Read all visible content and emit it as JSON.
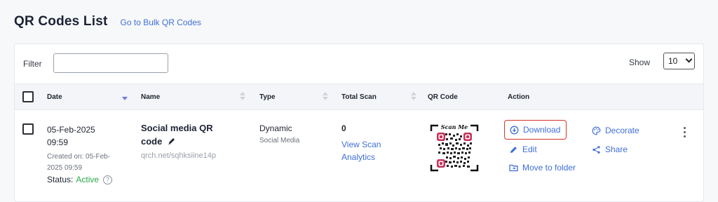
{
  "header": {
    "title": "QR Codes List",
    "bulk_link": "Go to Bulk QR Codes"
  },
  "toolbar": {
    "filter_label": "Filter",
    "filter_value": "",
    "show_label": "Show",
    "show_value": "10"
  },
  "table": {
    "columns": [
      "Date",
      "Name",
      "Type",
      "Total Scan",
      "QR Code",
      "Action"
    ],
    "sorted_column": "Date",
    "rows": [
      {
        "date": "05-Feb-2025",
        "time": "09:59",
        "created_prefix": "Created on: 05-Feb-",
        "created_suffix": "2025 09:59",
        "status_label": "Status:",
        "status_value": "Active",
        "name_line1": "Social media QR",
        "name_line2": "code",
        "short_url": "qrch.net/sqhksiine14p",
        "type": "Dynamic",
        "subtype": "Social Media",
        "total_scan": "0",
        "analytics_line1": "View Scan",
        "analytics_line2": "Analytics",
        "qr_caption": "Scan Me",
        "actions": {
          "download": "Download",
          "edit": "Edit",
          "move": "Move to folder",
          "decorate": "Decorate",
          "share": "Share"
        }
      }
    ]
  },
  "colors": {
    "link": "#3f6fd8",
    "active_status": "#27a845",
    "highlight_border": "#d9342b",
    "qr_accent": "#c8325a"
  }
}
